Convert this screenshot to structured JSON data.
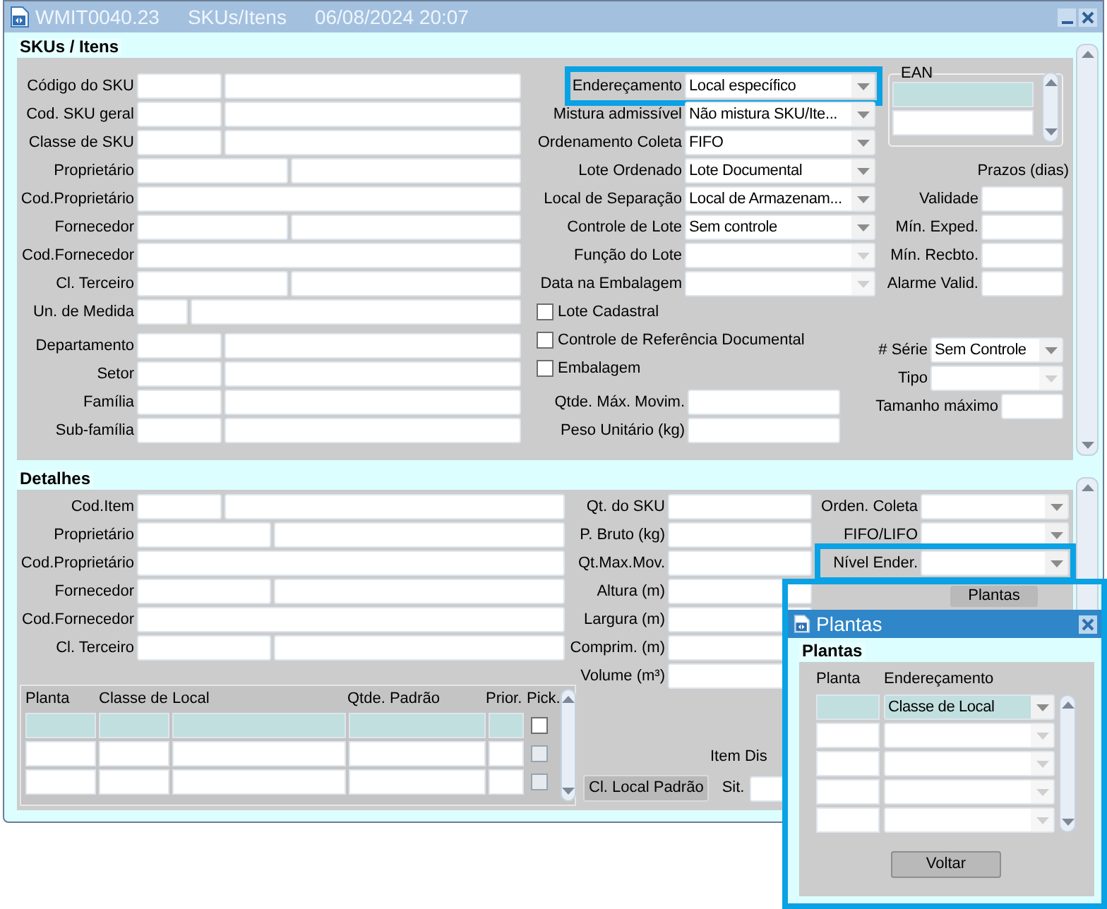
{
  "window": {
    "title": "WMIT0040.23",
    "subtitle": "SKUs/Itens",
    "timestamp": "06/08/2024 20:07"
  },
  "skus": {
    "title": "SKUs / Itens",
    "fields": [
      {
        "label": "Código do SKU",
        "kind": "code"
      },
      {
        "label": "Cod. SKU geral",
        "kind": "code"
      },
      {
        "label": "Classe de SKU",
        "kind": "code"
      },
      {
        "label": "Proprietário",
        "kind": "pair"
      },
      {
        "label": "Cod.Proprietário",
        "kind": "wide"
      },
      {
        "label": "Fornecedor",
        "kind": "pair"
      },
      {
        "label": "Cod.Fornecedor",
        "kind": "wide"
      },
      {
        "label": "Cl. Terceiro",
        "kind": "pair"
      },
      {
        "label": "Un. de  Medida",
        "kind": "unit"
      },
      {
        "label": "Departamento",
        "kind": "code"
      },
      {
        "label": "Setor",
        "kind": "code"
      },
      {
        "label": "Família",
        "kind": "code"
      },
      {
        "label": "Sub-família",
        "kind": "code"
      }
    ],
    "selects": [
      {
        "label": "Endereçamento",
        "value": "Local específico",
        "disabled": false,
        "highlighted": true
      },
      {
        "label": "Mistura admissível",
        "value": "Não mistura SKU/Ite...",
        "disabled": false,
        "highlighted": false
      },
      {
        "label": "Ordenamento Coleta",
        "value": "FIFO",
        "disabled": false,
        "highlighted": false
      },
      {
        "label": "Lote Ordenado",
        "value": "Lote Documental",
        "disabled": false,
        "highlighted": false
      },
      {
        "label": "Local de Separação",
        "value": "Local de Armazenam...",
        "disabled": false,
        "highlighted": false
      },
      {
        "label": "Controle de Lote",
        "value": "Sem controle",
        "disabled": false,
        "highlighted": false
      },
      {
        "label": "Função do Lote",
        "disabled": true,
        "highlighted": false
      },
      {
        "label": "Data na Embalagem",
        "disabled": true,
        "highlighted": false
      }
    ],
    "checkboxes": [
      {
        "label": "Lote Cadastral",
        "checked": false
      },
      {
        "label": "Controle de Referência Documental",
        "checked": false
      },
      {
        "label": "Embalagem",
        "checked": false
      }
    ],
    "inputs": [
      {
        "label": "Qtde. Máx. Movim."
      },
      {
        "label": "Peso Unitário (kg)"
      }
    ],
    "ean": {
      "title": "EAN",
      "rows": [
        {
          "selected": true
        },
        {
          "selected": false
        }
      ]
    },
    "deadlines": {
      "title": "Prazos (dias)",
      "fields": [
        {
          "label": "Validade"
        },
        {
          "label": "Mín. Exped."
        },
        {
          "label": "Mín. Recbto."
        },
        {
          "label": "Alarme Valid."
        }
      ]
    },
    "serial": [
      {
        "label": "# Série",
        "kind": "select",
        "value": "Sem Controle",
        "disabled": false
      },
      {
        "label": "Tipo",
        "kind": "select",
        "disabled": true
      },
      {
        "label": "Tamanho máximo",
        "kind": "input"
      }
    ]
  },
  "details": {
    "title": "Detalhes",
    "fields": [
      {
        "label": "Cod.Item",
        "kind": "code"
      },
      {
        "label": "Proprietário",
        "kind": "pair"
      },
      {
        "label": "Cod.Proprietário",
        "kind": "wide"
      },
      {
        "label": "Fornecedor",
        "kind": "pair"
      },
      {
        "label": "Cod.Fornecedor",
        "kind": "wide"
      },
      {
        "label": "Cl. Terceiro",
        "kind": "pair"
      }
    ],
    "measures": [
      {
        "label": "Qt. do SKU"
      },
      {
        "label": "P. Bruto (kg)"
      },
      {
        "label": "Qt.Max.Mov."
      },
      {
        "label": "Altura (m)"
      },
      {
        "label": "Largura (m)"
      },
      {
        "label": "Comprim. (m)"
      },
      {
        "label": "Volume (m³)"
      }
    ],
    "selects": [
      {
        "label": "Orden. Coleta",
        "disabled": false,
        "highlighted": false
      },
      {
        "label": "FIFO/LIFO",
        "disabled": false,
        "highlighted": false
      },
      {
        "label": "Nível Ender.",
        "disabled": false,
        "highlighted": true
      }
    ],
    "plantas_button": "Plantas",
    "grid": {
      "columns": [
        "Planta",
        "Classe de Local",
        "Qtde. Padrão",
        "Prior.",
        "Pick."
      ],
      "rows": [
        {
          "selected": true,
          "checked": false,
          "disabled": false
        },
        {
          "selected": false,
          "checked": false,
          "disabled": true
        },
        {
          "selected": false,
          "checked": false,
          "disabled": true
        }
      ]
    },
    "item_label": "Item Dis",
    "default_location_button": "Cl. Local Padrão",
    "status_label": "Sit."
  },
  "dialog": {
    "title": "Plantas",
    "section": "Plantas",
    "highlighted": true,
    "columns": [
      "Planta",
      "Endereçamento"
    ],
    "rows": [
      {
        "value": "Classe de Local",
        "selected": true,
        "disabled": false
      },
      {
        "selected": false,
        "disabled": true
      },
      {
        "selected": false,
        "disabled": true
      },
      {
        "selected": false,
        "disabled": true
      },
      {
        "selected": false,
        "disabled": true
      }
    ],
    "button": "Voltar"
  }
}
